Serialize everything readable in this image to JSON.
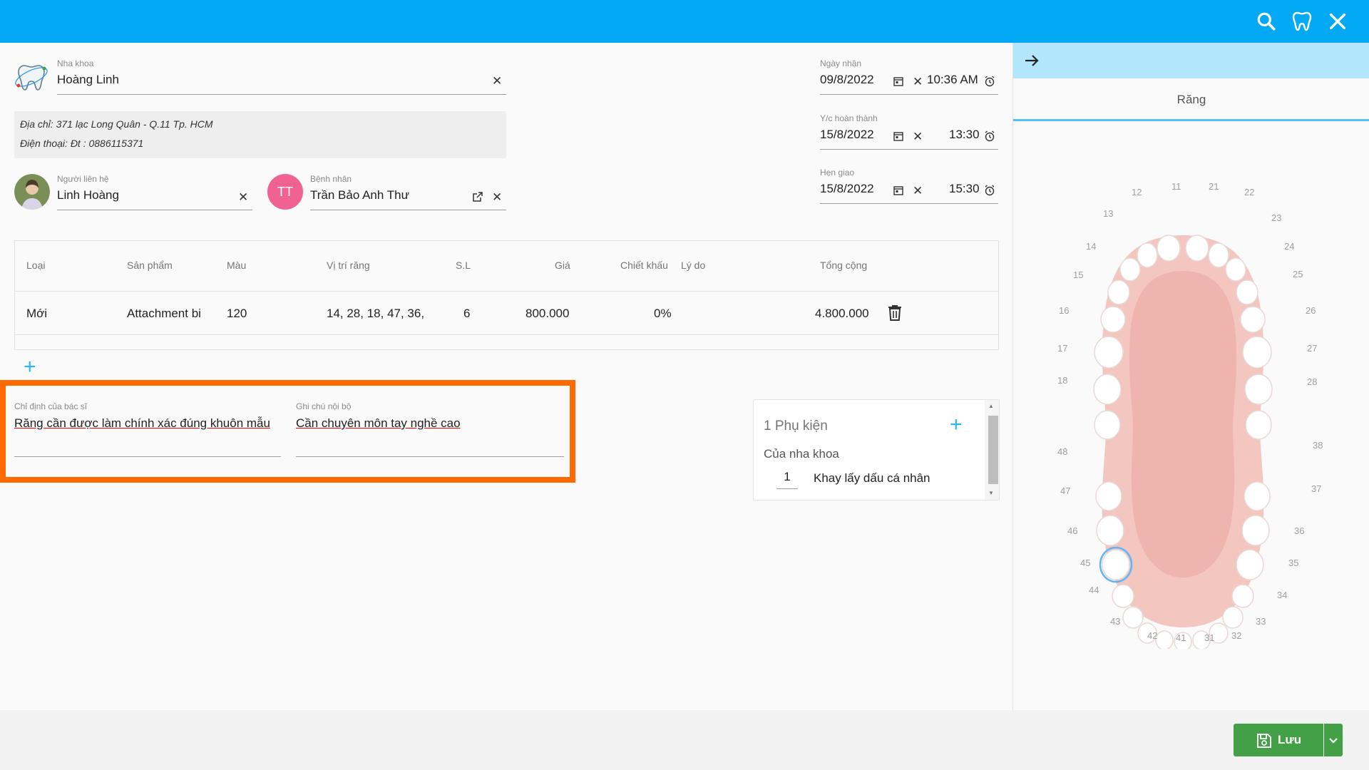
{
  "clinic": {
    "label": "Nha khoa",
    "value": "Hoàng Linh",
    "address": "Địa chỉ: 371 lạc Long Quân - Q.11 Tp. HCM",
    "phone": "Điện thoại: Đt : 0886115371"
  },
  "contact": {
    "label": "Người liên hệ",
    "value": "Linh Hoàng"
  },
  "patient": {
    "label": "Bệnh nhân",
    "value": "Trần Bảo Anh Thư",
    "initials": "TT"
  },
  "dates": [
    {
      "label": "Ngày nhận",
      "date": "09/8/2022",
      "time": "10:36 AM"
    },
    {
      "label": "Y/c hoàn thành",
      "date": "15/8/2022",
      "time": "13:30"
    },
    {
      "label": "Hẹn giao",
      "date": "15/8/2022",
      "time": "15:30"
    }
  ],
  "table": {
    "headers": {
      "type": "Loại",
      "product": "Sản phẩm",
      "color": "Màu",
      "position": "Vị trí răng",
      "qty": "S.L",
      "price": "Giá",
      "discount": "Chiết khấu",
      "reason": "Lý do",
      "total": "Tổng cộng"
    },
    "rows": [
      {
        "type": "Mới",
        "product": "Attachment bi",
        "color": "120",
        "position": "14, 28, 18, 47, 36,",
        "qty": "6",
        "price": "800.000",
        "discount": "0%",
        "reason": "",
        "total": "4.800.000"
      }
    ]
  },
  "doctor_note": {
    "label": "Chỉ định của bác sĩ",
    "value": "Răng cần được làm chính xác đúng khuôn mẫu"
  },
  "internal_note": {
    "label": "Ghi chú nội bộ",
    "value": "Cần chuyên môn tay nghề cao"
  },
  "accessories": {
    "title": "1 Phụ kiện",
    "group": "Của nha khoa",
    "items": [
      {
        "qty": "1",
        "name": "Khay lấy dấu cá nhân"
      }
    ]
  },
  "teeth_panel": {
    "tab": "Răng",
    "numbers": [
      "11",
      "12",
      "13",
      "14",
      "15",
      "16",
      "17",
      "18",
      "21",
      "22",
      "23",
      "24",
      "25",
      "26",
      "27",
      "28",
      "31",
      "32",
      "33",
      "34",
      "35",
      "36",
      "37",
      "38",
      "41",
      "42",
      "43",
      "44",
      "45",
      "46",
      "47",
      "48"
    ]
  },
  "save": {
    "label": "Lưu"
  },
  "colors": {
    "topbar": "#03a9f4",
    "save": "#43a047",
    "highlight": "#ff6a00",
    "patient_avatar": "#f06292"
  },
  "icons": {
    "search": "search-icon",
    "tooth": "tooth-icon",
    "close": "close-icon"
  }
}
